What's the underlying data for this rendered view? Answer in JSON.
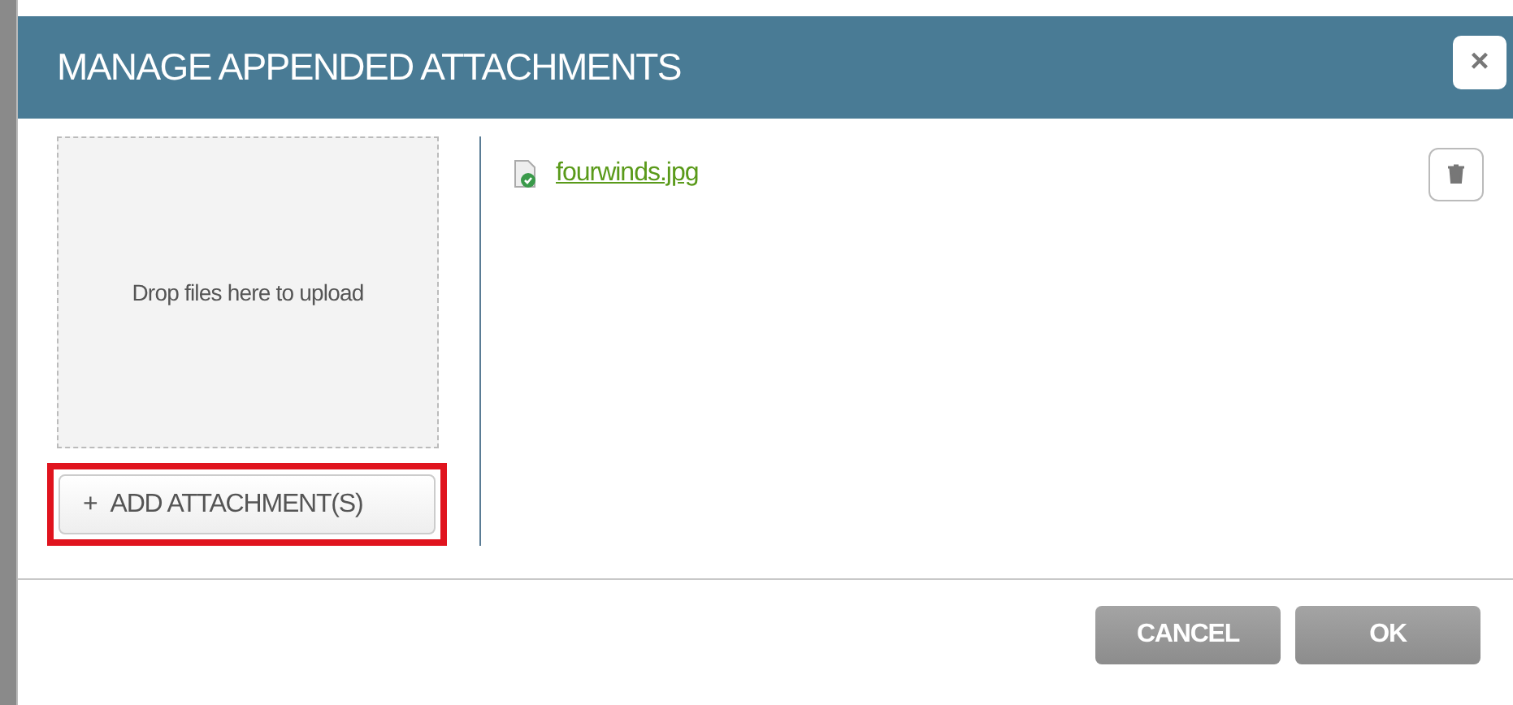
{
  "dialog": {
    "title": "MANAGE APPENDED ATTACHMENTS",
    "close_label": "×"
  },
  "dropzone": {
    "text": "Drop files here to upload"
  },
  "add_button": {
    "icon": "+",
    "label": "ADD ATTACHMENT(S)",
    "highlighted": true
  },
  "files": [
    {
      "name": "fourwinds.jpg"
    }
  ],
  "buttons": [
    {
      "label": "CANCEL"
    },
    {
      "label": "OK"
    }
  ]
}
